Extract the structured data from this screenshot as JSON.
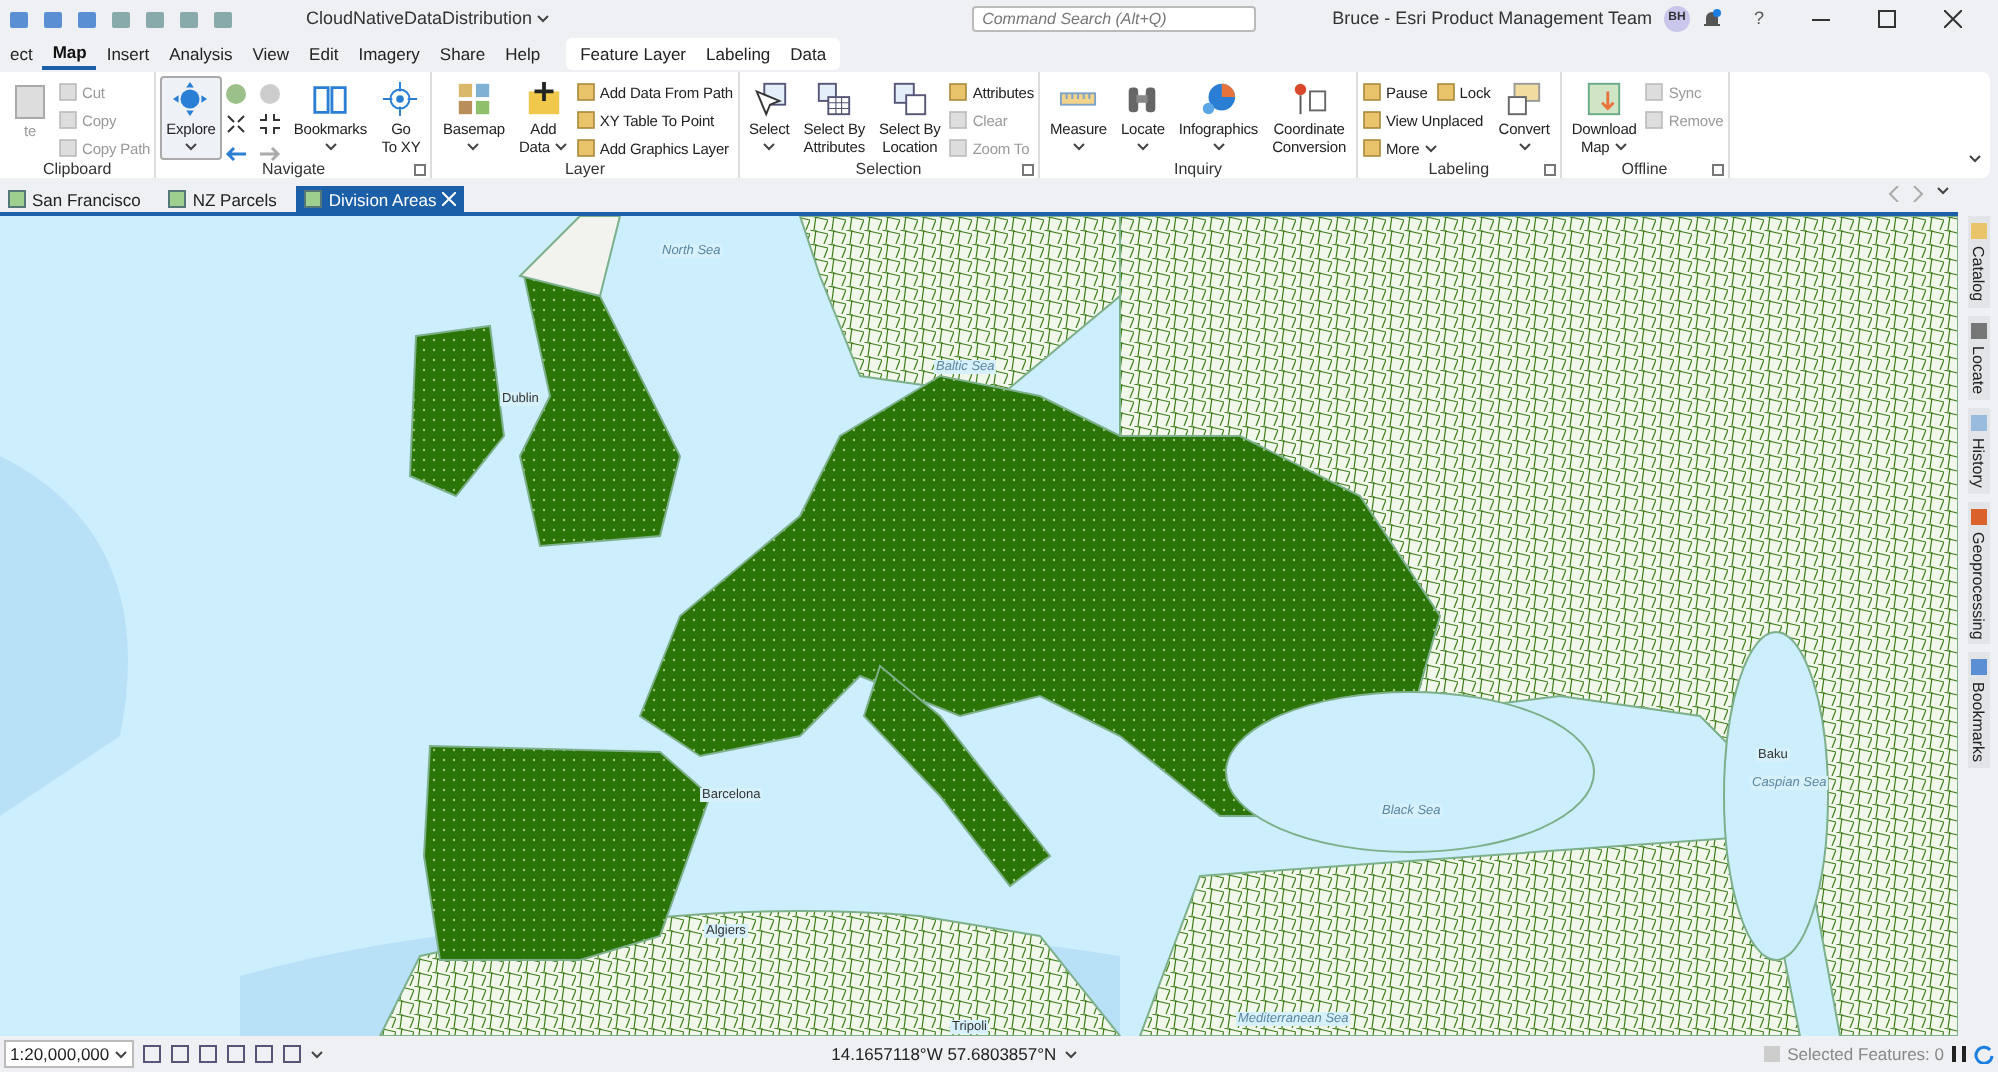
{
  "title_bar": {
    "document": "CloudNativeDataDistribution",
    "search": {
      "placeholder": "Command Search (Alt+Q)"
    },
    "user": "Bruce - Esri Product Management Team",
    "avatar": "BH",
    "help": "?"
  },
  "menu_tabs": [
    {
      "label": "ect",
      "selected": false
    },
    {
      "label": "Map",
      "selected": true
    },
    {
      "label": "Insert",
      "selected": false
    },
    {
      "label": "Analysis",
      "selected": false
    },
    {
      "label": "View",
      "selected": false
    },
    {
      "label": "Edit",
      "selected": false
    },
    {
      "label": "Imagery",
      "selected": false
    },
    {
      "label": "Share",
      "selected": false
    },
    {
      "label": "Help",
      "selected": false
    }
  ],
  "contextual_tabs": [
    {
      "label": "Feature Layer",
      "selected": false
    },
    {
      "label": "Labeling",
      "selected": false
    },
    {
      "label": "Data",
      "selected": false
    }
  ],
  "ribbon_groups": [
    {
      "name": "Clipboard",
      "launcher": false,
      "columns": [
        {
          "kind": "large",
          "label": [
            "te"
          ],
          "dropdown": false,
          "disabled": true,
          "selected": false
        },
        {
          "kind": "stack",
          "rows": [
            [
              {
                "label": "Cut",
                "disabled": true,
                "dropdown": false
              }
            ],
            [
              {
                "label": "Copy",
                "disabled": true,
                "dropdown": false
              }
            ],
            [
              {
                "label": "Copy Path",
                "disabled": true,
                "dropdown": false
              }
            ]
          ]
        }
      ]
    },
    {
      "name": "Navigate",
      "launcher": true,
      "columns": [
        {
          "kind": "large",
          "label": [
            "Explore"
          ],
          "dropdown": true,
          "disabled": false,
          "selected": true
        },
        {
          "kind": "nav_tools"
        },
        {
          "kind": "large",
          "label": [
            "Bookmarks"
          ],
          "dropdown": true,
          "disabled": false,
          "selected": false
        },
        {
          "kind": "large",
          "label": [
            "Go",
            "To XY"
          ],
          "dropdown": false,
          "disabled": false,
          "selected": false
        }
      ]
    },
    {
      "name": "Layer",
      "launcher": false,
      "columns": [
        {
          "kind": "large",
          "label": [
            "Basemap"
          ],
          "dropdown": true,
          "disabled": false,
          "selected": false
        },
        {
          "kind": "large",
          "label": [
            "Add",
            "Data"
          ],
          "dropdown": true,
          "disabled": false,
          "selected": false
        },
        {
          "kind": "stack",
          "rows": [
            [
              {
                "label": "Add Data From Path",
                "disabled": false,
                "dropdown": false
              }
            ],
            [
              {
                "label": "XY Table To Point",
                "disabled": false,
                "dropdown": false
              }
            ],
            [
              {
                "label": "Add Graphics Layer",
                "disabled": false,
                "dropdown": false
              }
            ]
          ]
        }
      ]
    },
    {
      "name": "Selection",
      "launcher": true,
      "columns": [
        {
          "kind": "large",
          "label": [
            "Select"
          ],
          "dropdown": true,
          "disabled": false,
          "selected": false
        },
        {
          "kind": "large",
          "label": [
            "Select By",
            "Attributes"
          ],
          "dropdown": false,
          "disabled": false,
          "selected": false
        },
        {
          "kind": "large",
          "label": [
            "Select By",
            "Location"
          ],
          "dropdown": false,
          "disabled": false,
          "selected": false
        },
        {
          "kind": "stack",
          "rows": [
            [
              {
                "label": "Attributes",
                "disabled": false,
                "dropdown": false
              }
            ],
            [
              {
                "label": "Clear",
                "disabled": true,
                "dropdown": false
              }
            ],
            [
              {
                "label": "Zoom To",
                "disabled": true,
                "dropdown": false
              }
            ]
          ]
        }
      ]
    },
    {
      "name": "Inquiry",
      "launcher": false,
      "columns": [
        {
          "kind": "large",
          "label": [
            "Measure"
          ],
          "dropdown": true,
          "disabled": false,
          "selected": false
        },
        {
          "kind": "large",
          "label": [
            "Locate"
          ],
          "dropdown": true,
          "disabled": false,
          "selected": false
        },
        {
          "kind": "large",
          "label": [
            "Infographics"
          ],
          "dropdown": true,
          "disabled": false,
          "selected": false
        },
        {
          "kind": "large",
          "label": [
            "Coordinate",
            "Conversion"
          ],
          "dropdown": false,
          "disabled": false,
          "selected": false
        }
      ]
    },
    {
      "name": "Labeling",
      "launcher": true,
      "columns": [
        {
          "kind": "stack",
          "rows": [
            [
              {
                "label": "Pause",
                "disabled": false,
                "dropdown": false
              },
              {
                "label": "Lock",
                "disabled": false,
                "dropdown": false
              }
            ],
            [
              {
                "label": "View Unplaced",
                "disabled": false,
                "dropdown": false
              }
            ],
            [
              {
                "label": "More",
                "disabled": false,
                "dropdown": true
              }
            ]
          ]
        },
        {
          "kind": "large",
          "label": [
            "Convert"
          ],
          "dropdown": true,
          "disabled": false,
          "selected": false
        }
      ]
    },
    {
      "name": "Offline",
      "launcher": true,
      "columns": [
        {
          "kind": "large",
          "label": [
            "Download",
            "Map"
          ],
          "dropdown": true,
          "disabled": false,
          "selected": false
        },
        {
          "kind": "stack",
          "rows": [
            [
              {
                "label": "Sync",
                "disabled": true,
                "dropdown": false
              }
            ],
            [
              {
                "label": "Remove",
                "disabled": true,
                "dropdown": false
              }
            ]
          ]
        }
      ]
    }
  ],
  "view_tabs": [
    {
      "label": "San Francisco",
      "selected": false
    },
    {
      "label": "NZ Parcels",
      "selected": false
    },
    {
      "label": "Division Areas",
      "selected": true
    }
  ],
  "map_labels": [
    "North Sea",
    "Dublin",
    "Baltic Sea",
    "Barcelona",
    "Black Sea",
    "Caspian Sea",
    "Baku",
    "Algiers",
    "Mediterranean Sea",
    "Tripoli"
  ],
  "dock_tabs": [
    "Catalog",
    "Locate",
    "History",
    "Geoprocessing",
    "Bookmarks"
  ],
  "status_bar": {
    "scale": "1:20,000,000",
    "coordinates": "14.1657118°W 57.6803857°N",
    "selected_features": "Selected Features: 0"
  }
}
